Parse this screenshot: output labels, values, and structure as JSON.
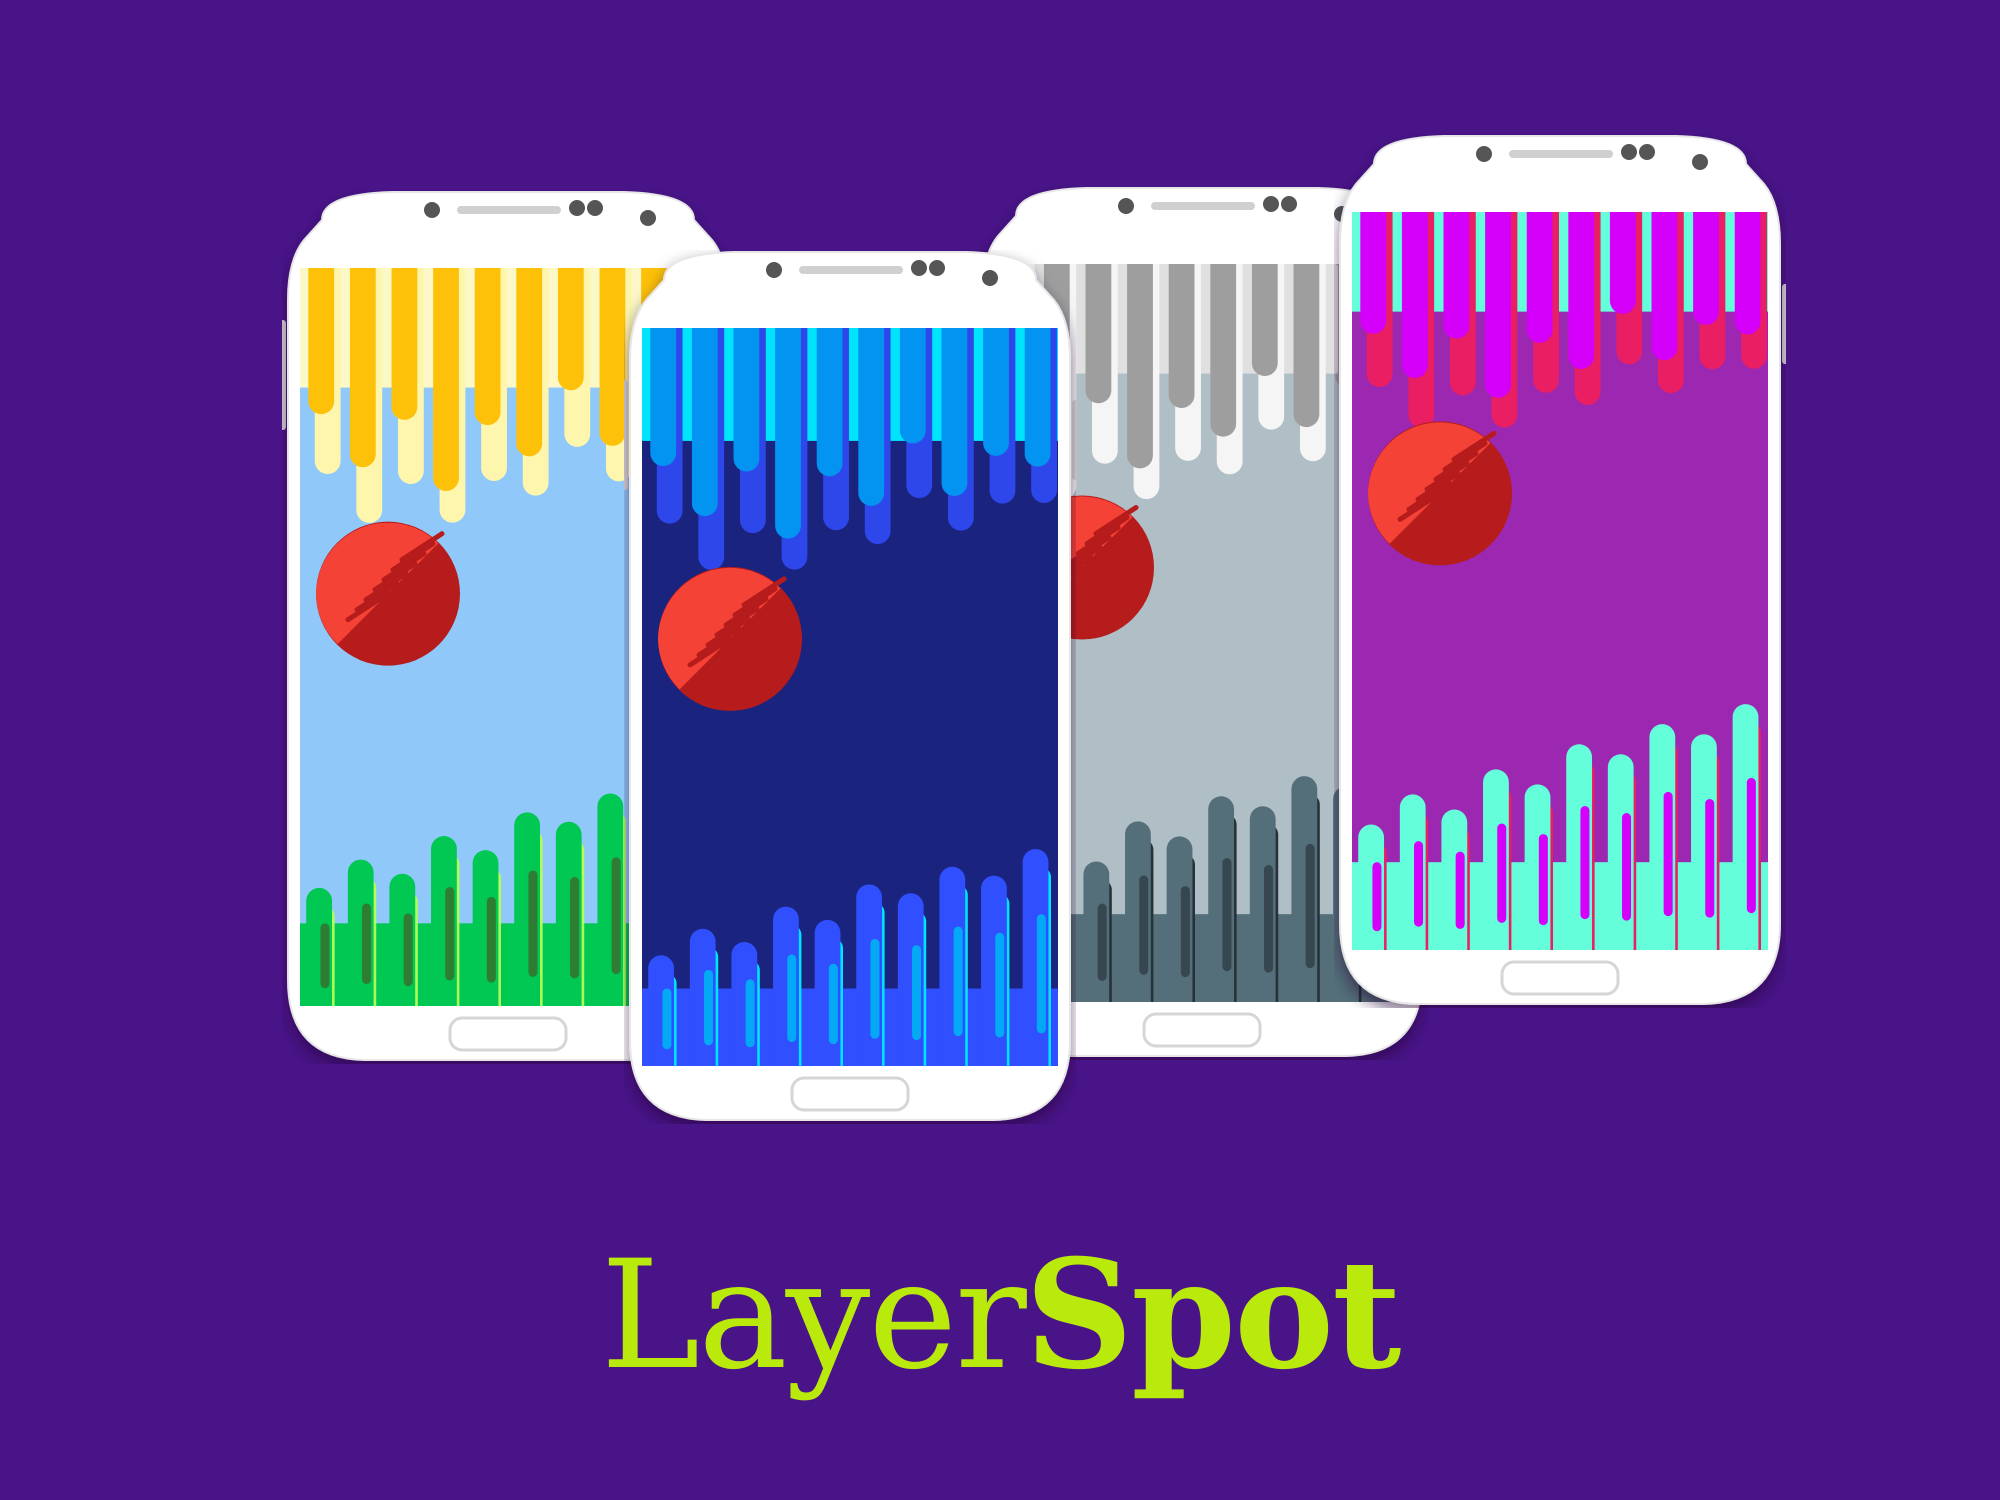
{
  "background_color": "#4a1489",
  "brand": {
    "part_light": "Layer",
    "part_bold": "Spot",
    "color": "#b9ea0b"
  },
  "phones": [
    {
      "id": "yellow",
      "top_fill": "#fdf8c8",
      "drip_back": "#fff6ad",
      "drip_front": "#fec109",
      "mid_fill": "#90c9f9",
      "bottom_fill": "#00c853",
      "rise_accent": "#b2ff59",
      "rise_shadow": "#2e7d32",
      "top_depth": 0.36,
      "bottom_rise": 0.32
    },
    {
      "id": "blue",
      "top_fill": "#00e3fd",
      "drip_back": "#2e47ea",
      "drip_front": "#0394f1",
      "mid_fill": "#1a237e",
      "bottom_fill": "#304ffe",
      "rise_accent": "#00e5ff",
      "rise_shadow": "#03a9f4",
      "top_depth": 0.34,
      "bottom_rise": 0.3
    },
    {
      "id": "grey",
      "top_fill": "#e0e0e0",
      "drip_back": "#f5f5f5",
      "drip_front": "#9e9e9e",
      "mid_fill": "#b0bec5",
      "bottom_fill": "#546e7a",
      "rise_accent": "#263238",
      "rise_shadow": "#37474f",
      "top_depth": 0.33,
      "bottom_rise": 0.34
    },
    {
      "id": "magenta",
      "top_fill": "#64ffda",
      "drip_back": "#e91e63",
      "drip_front": "#d500f9",
      "mid_fill": "#9c27b0",
      "bottom_fill": "#64ffda",
      "rise_accent": "#e91e63",
      "rise_shadow": "#d500f9",
      "top_depth": 0.3,
      "bottom_rise": 0.34
    }
  ]
}
